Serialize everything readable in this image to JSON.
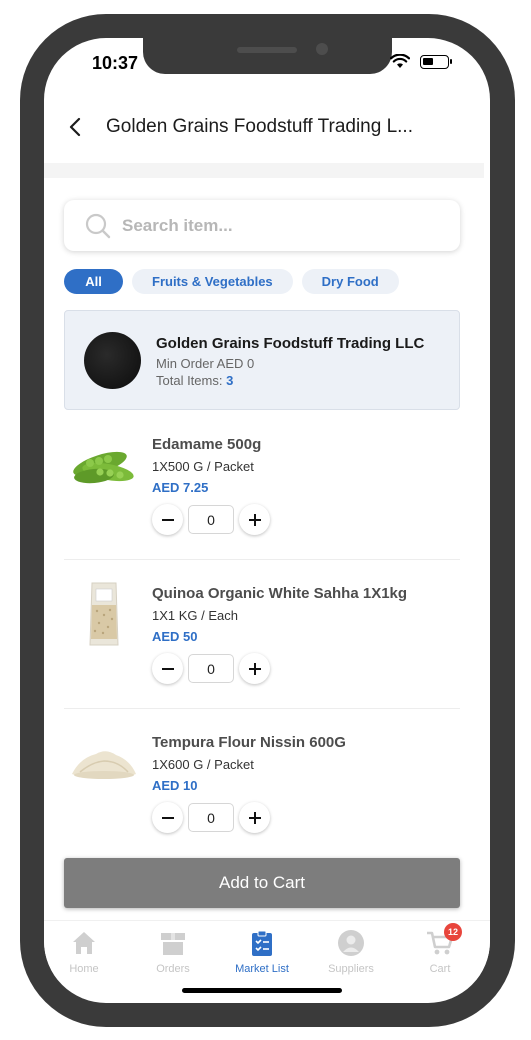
{
  "status_bar": {
    "time": "10:37"
  },
  "header": {
    "title": "Golden Grains Foodstuff Trading L..."
  },
  "search": {
    "placeholder": "Search item..."
  },
  "filters": [
    {
      "label": "All",
      "active": true
    },
    {
      "label": "Fruits & Vegetables",
      "active": false
    },
    {
      "label": "Dry Food",
      "active": false
    }
  ],
  "supplier": {
    "name": "Golden Grains Foodstuff Trading LLC",
    "min_order": "Min Order AED 0",
    "total_label": "Total Items:",
    "total_count": "3"
  },
  "products": [
    {
      "name": "Edamame 500g",
      "unit": "1X500 G / Packet",
      "price": "AED 7.25",
      "qty": "0",
      "icon": "edamame-image"
    },
    {
      "name": "Quinoa Organic White Sahha 1X1kg",
      "unit": "1X1 KG / Each",
      "price": "AED 50",
      "qty": "0",
      "icon": "quinoa-bag-image"
    },
    {
      "name": "Tempura Flour Nissin 600G",
      "unit": "1X600 G / Packet",
      "price": "AED 10",
      "qty": "0",
      "icon": "flour-pile-image"
    }
  ],
  "add_to_cart": {
    "label": "Add to Cart"
  },
  "tabbar": {
    "items": [
      {
        "label": "Home",
        "icon": "home-icon"
      },
      {
        "label": "Orders",
        "icon": "box-icon"
      },
      {
        "label": "Market List",
        "icon": "clipboard-list-icon",
        "active": true
      },
      {
        "label": "Suppliers",
        "icon": "user-icon"
      },
      {
        "label": "Cart",
        "icon": "cart-icon",
        "badge": "12"
      }
    ]
  },
  "colors": {
    "accent": "#2f6fc6",
    "badge": "#e8453c",
    "frame": "#3a3a3a"
  }
}
